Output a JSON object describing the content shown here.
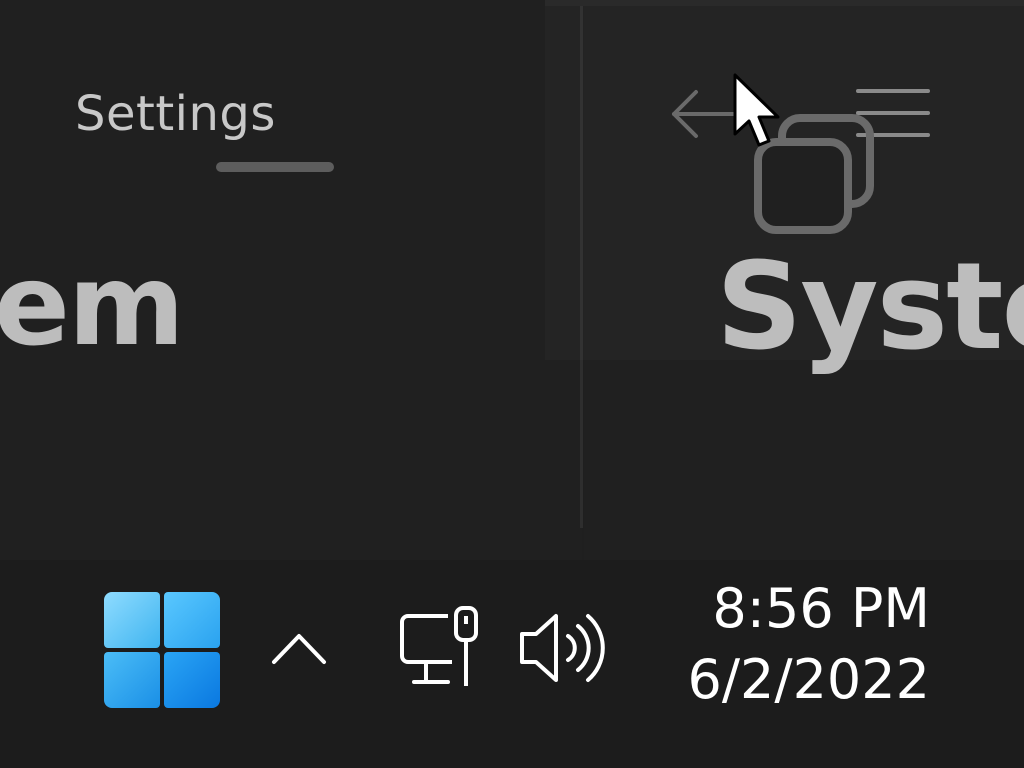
{
  "left_window": {
    "title": "Settings",
    "heading_fragment": "em"
  },
  "right_window": {
    "heading_fragment": "Syste",
    "toolbar": {
      "back_icon": "back-arrow-icon",
      "menu_icon": "hamburger-menu-icon",
      "window_icon": "restore-window-icon"
    }
  },
  "taskbar": {
    "start_icon": "windows-logo-icon",
    "overflow_icon": "chevron-up-icon",
    "network_icon": "ethernet-network-icon",
    "volume_icon": "speaker-volume-icon",
    "time": "8:56 PM",
    "date": "6/2/2022"
  },
  "colors": {
    "background": "#1f1f1f",
    "text_primary": "#ffffff",
    "text_muted": "#bdbdbd",
    "accent": "#1a8fe6"
  }
}
